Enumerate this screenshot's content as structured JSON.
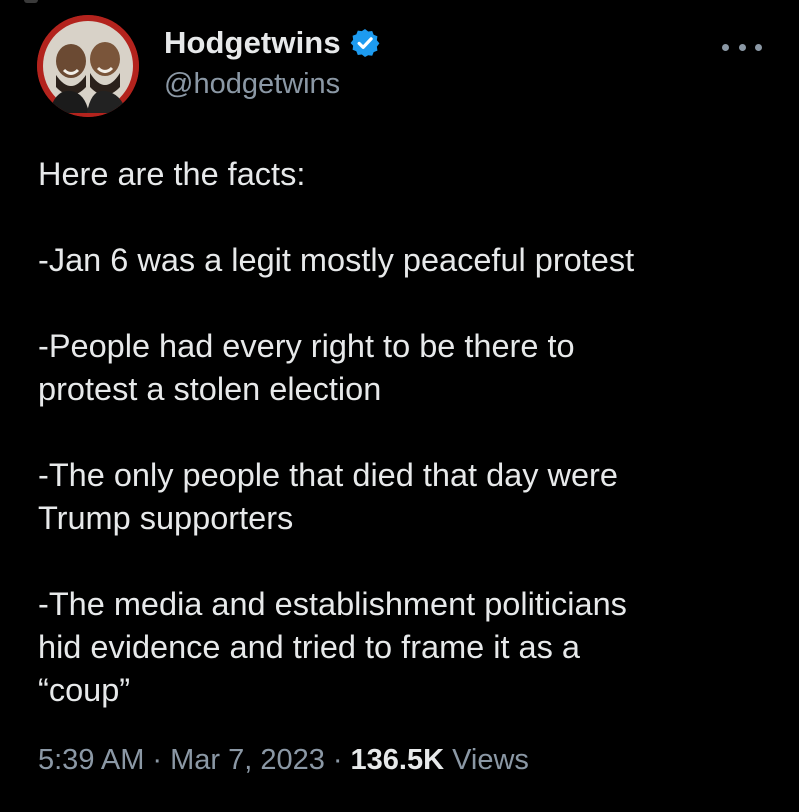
{
  "author": {
    "display_name": "Hodgetwins",
    "handle": "@hodgetwins",
    "verified": true,
    "avatar_icon": "avatar-photo-two-men"
  },
  "more_menu_icon": "more-horizontal-icon",
  "tweet_paragraphs": [
    "Here are the facts:",
    "-Jan 6 was a legit mostly peaceful protest",
    "-People had every right to be there to\nprotest a stolen election",
    "-The only people that died that day were\nTrump supporters",
    "-The media and establishment politicians\nhid evidence and tried to frame it as a\n“coup”"
  ],
  "meta": {
    "time": "5:39 AM",
    "separator": "·",
    "date": "Mar 7, 2023",
    "views_count": "136.5K",
    "views_label": "Views"
  },
  "colors": {
    "background": "#000000",
    "primary_text": "#e7e9ea",
    "secondary_text": "#8b98a5",
    "verified_badge": "#1d9bf0",
    "avatar_ring": "#b3231d"
  }
}
